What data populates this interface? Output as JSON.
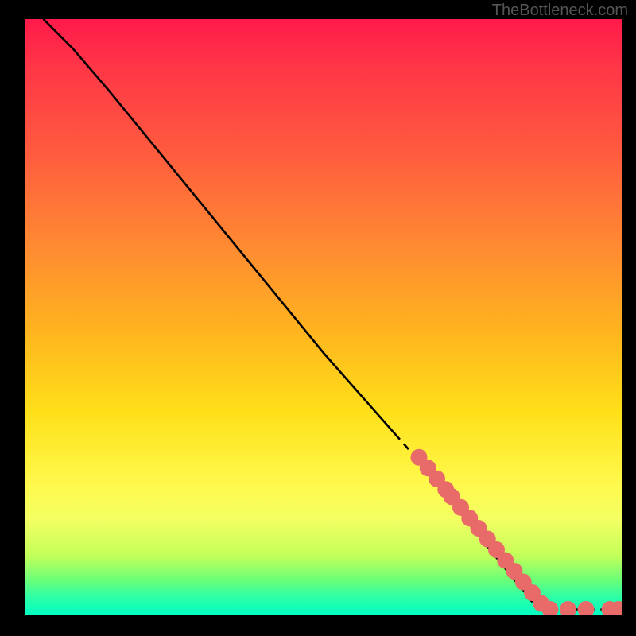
{
  "watermark": "TheBottleneck.com",
  "chart_data": {
    "type": "line",
    "title": "",
    "xlabel": "",
    "ylabel": "",
    "xlim": [
      0,
      100
    ],
    "ylim": [
      0,
      100
    ],
    "curve": [
      {
        "x": 3,
        "y": 100
      },
      {
        "x": 8,
        "y": 95
      },
      {
        "x": 14,
        "y": 88
      },
      {
        "x": 50,
        "y": 44
      },
      {
        "x": 65,
        "y": 27
      },
      {
        "x": 86,
        "y": 1
      },
      {
        "x": 100,
        "y": 1
      }
    ],
    "dashed_segment_start_x": 62,
    "markers": [
      {
        "x": 66,
        "y": 26.5,
        "k": "dot"
      },
      {
        "x": 67.5,
        "y": 24.7,
        "k": "dot"
      },
      {
        "x": 69,
        "y": 22.9,
        "k": "dot"
      },
      {
        "x": 70.5,
        "y": 21.1,
        "k": "dot"
      },
      {
        "x": 71.5,
        "y": 19.9,
        "k": "dot"
      },
      {
        "x": 73,
        "y": 18.1,
        "k": "dot"
      },
      {
        "x": 74.5,
        "y": 16.3,
        "k": "dot"
      },
      {
        "x": 76,
        "y": 14.6,
        "k": "dot"
      },
      {
        "x": 77.5,
        "y": 12.8,
        "k": "dot"
      },
      {
        "x": 79,
        "y": 11.0,
        "k": "dot"
      },
      {
        "x": 80.5,
        "y": 9.2,
        "k": "dot"
      },
      {
        "x": 82,
        "y": 7.4,
        "k": "dot"
      },
      {
        "x": 83.5,
        "y": 5.6,
        "k": "dot"
      },
      {
        "x": 85,
        "y": 3.8,
        "k": "dot"
      },
      {
        "x": 86.5,
        "y": 2.0,
        "k": "dot"
      },
      {
        "x": 88,
        "y": 1.0,
        "k": "dot"
      },
      {
        "x": 91,
        "y": 1.0,
        "k": "dot"
      },
      {
        "x": 94,
        "y": 1.0,
        "k": "dot"
      },
      {
        "x": 98,
        "y": 1.0,
        "k": "dot"
      },
      {
        "x": 99.5,
        "y": 1.0,
        "k": "dot"
      }
    ],
    "marker_style": {
      "fill": "#e86a69",
      "r": 1.4
    },
    "gradient_stops": [
      {
        "p": 0,
        "c": "#ff1a4b"
      },
      {
        "p": 8,
        "c": "#ff3647"
      },
      {
        "p": 22,
        "c": "#ff5a3f"
      },
      {
        "p": 38,
        "c": "#ff8a32"
      },
      {
        "p": 52,
        "c": "#ffb31f"
      },
      {
        "p": 66,
        "c": "#ffe019"
      },
      {
        "p": 78,
        "c": "#fff94d"
      },
      {
        "p": 84,
        "c": "#f3ff63"
      },
      {
        "p": 90,
        "c": "#c3ff5a"
      },
      {
        "p": 94,
        "c": "#6cff77"
      },
      {
        "p": 97,
        "c": "#2dffa7"
      },
      {
        "p": 100,
        "c": "#00ffc3"
      }
    ]
  }
}
